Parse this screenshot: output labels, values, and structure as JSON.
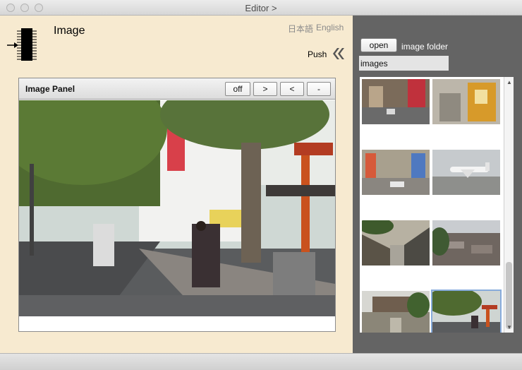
{
  "window": {
    "title": "Editor >"
  },
  "header": {
    "app_title": "Image",
    "lang_ja": "日本語",
    "lang_en": "English",
    "push_label": "Push"
  },
  "image_panel": {
    "title": "Image Panel",
    "buttons": {
      "off": "off",
      "next": ">",
      "prev": "<",
      "minus": "-"
    }
  },
  "sidebar": {
    "open_label": "open",
    "folder_label": "image folder",
    "folder_value": "images",
    "selected_index": 7,
    "thumbnails": [
      {
        "name": "street-cars"
      },
      {
        "name": "shop-entrance"
      },
      {
        "name": "shopping-street"
      },
      {
        "name": "airplane"
      },
      {
        "name": "stone-wall-lane"
      },
      {
        "name": "rooftops"
      },
      {
        "name": "garden-house"
      },
      {
        "name": "torii-street"
      }
    ]
  },
  "colors": {
    "left_background": "#f7ead0",
    "right_background": "#646464",
    "selection": "#87abdb"
  }
}
